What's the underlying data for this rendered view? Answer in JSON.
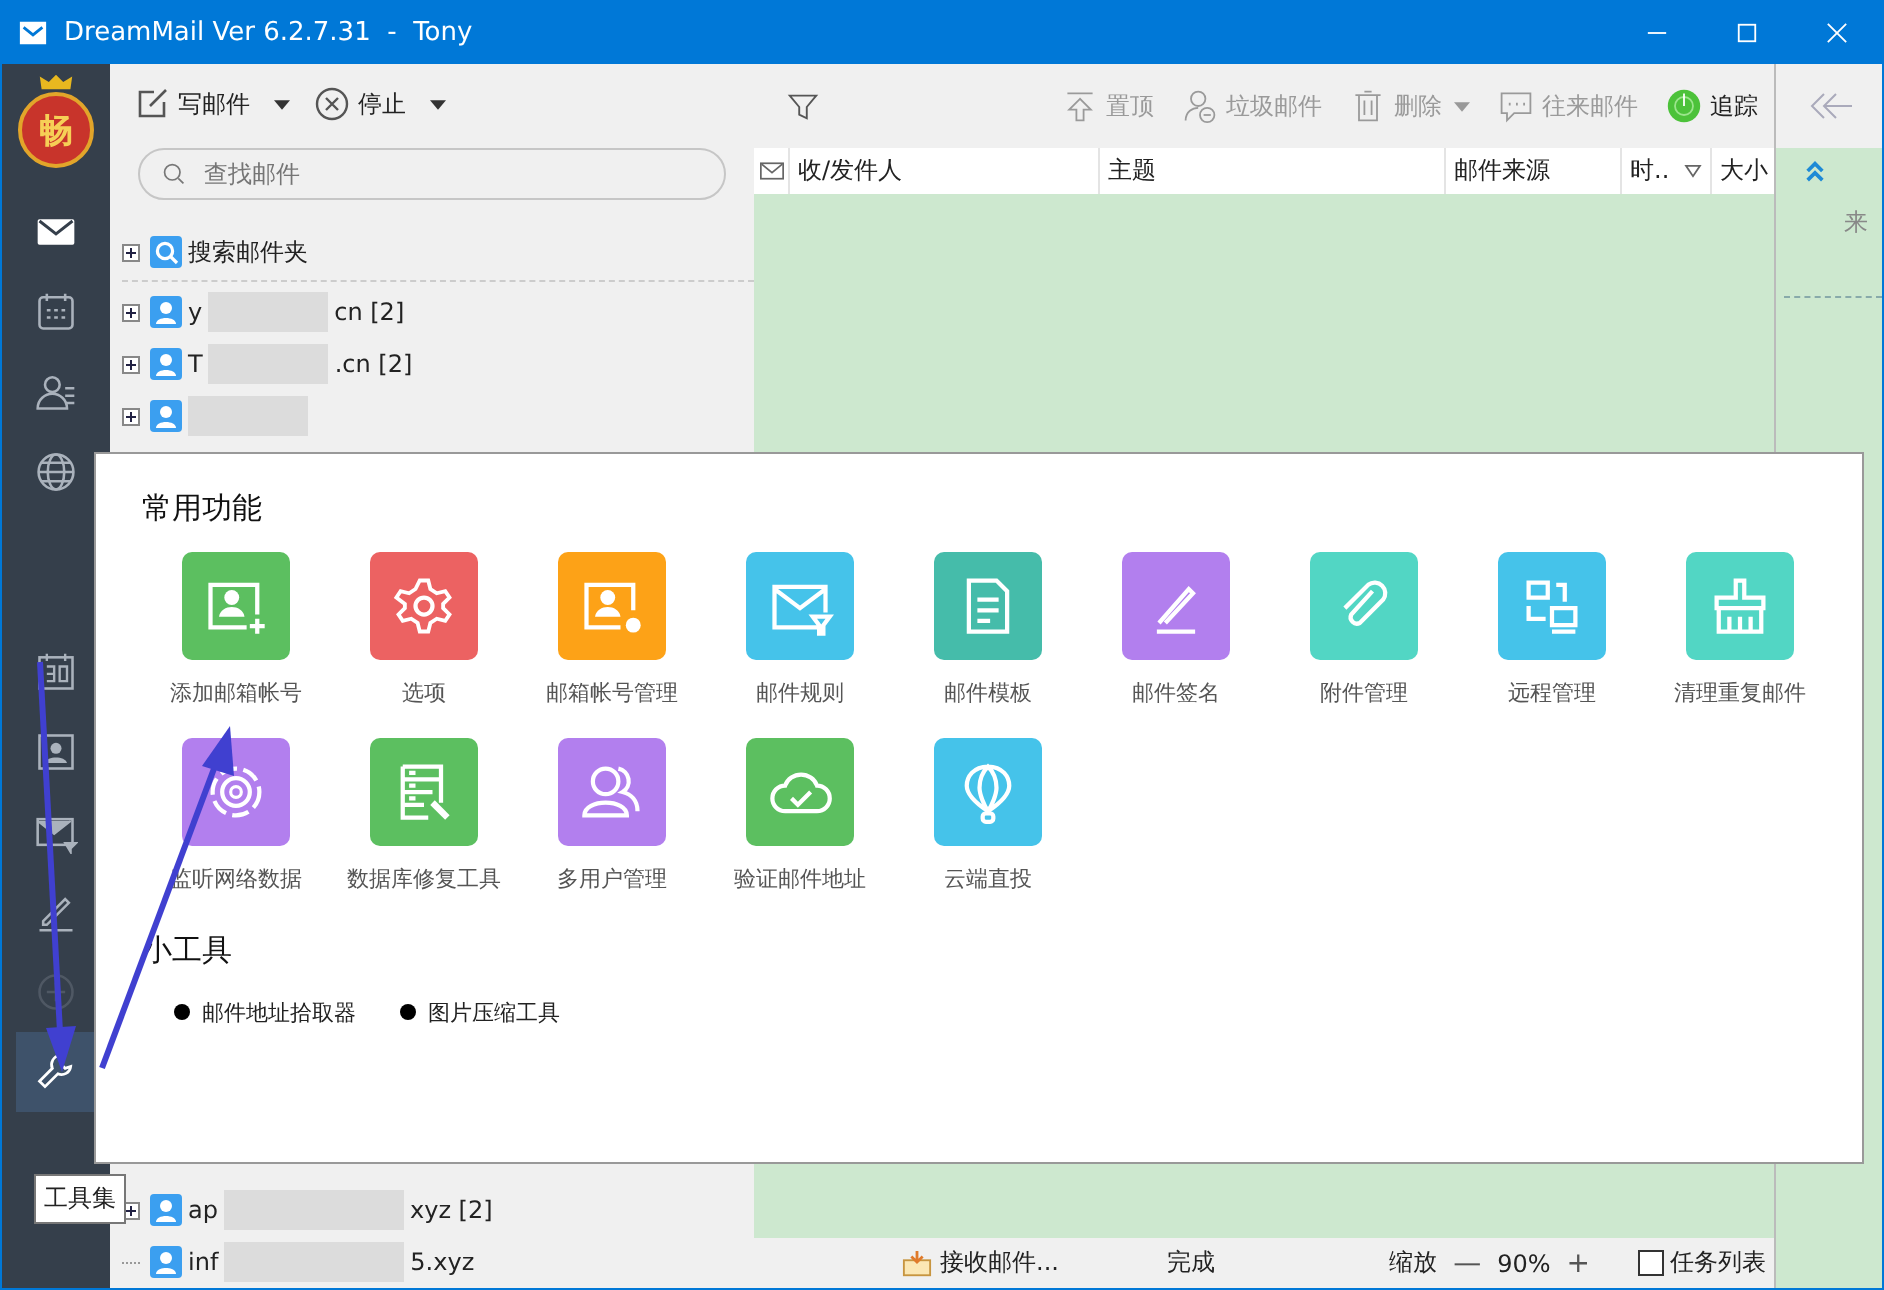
{
  "window": {
    "title": "DreamMail Ver 6.2.7.31  -  Tony"
  },
  "logo": {
    "text": "畅"
  },
  "sidebar": {
    "items": [
      {
        "kind": "mail",
        "selected": true
      },
      {
        "kind": "calendar",
        "selected": false
      },
      {
        "kind": "contacts",
        "selected": false
      },
      {
        "kind": "globe",
        "selected": false
      },
      {
        "kind": "date",
        "selected": false
      },
      {
        "kind": "card",
        "selected": false
      },
      {
        "kind": "filter",
        "selected": false
      },
      {
        "kind": "pen",
        "selected": false
      },
      {
        "kind": "plus",
        "selected": false
      },
      {
        "kind": "wrench",
        "selected": true
      }
    ]
  },
  "tooltip": "工具集",
  "toolbar": [
    {
      "kind": "compose",
      "label": "写邮件",
      "dropdown": true
    },
    {
      "kind": "stop",
      "label": "停止",
      "dropdown": true
    }
  ],
  "search": {
    "placeholder": "查找邮件"
  },
  "folders": [
    {
      "kind": "search",
      "label": "搜索邮件夹"
    },
    {
      "kind": "account",
      "label_start": "y",
      "label_end": "cn [2]"
    },
    {
      "kind": "account",
      "label_start": "T",
      "label_end": ".cn [2]"
    },
    {
      "kind": "group"
    }
  ],
  "folders_bottom": [
    {
      "label_start": "ap",
      "label_end": "xyz [2]",
      "expandable": true
    },
    {
      "label_start": "inf",
      "label_end": "5.xyz",
      "expandable": false
    }
  ],
  "mail_toolbar": [
    {
      "kind": "pin",
      "label": "置顶",
      "disabled": true,
      "dropdown": false
    },
    {
      "kind": "spam",
      "label": "垃圾邮件",
      "disabled": true,
      "dropdown": false
    },
    {
      "kind": "delete",
      "label": "删除",
      "disabled": true,
      "dropdown": true
    },
    {
      "kind": "thread",
      "label": "往来邮件",
      "disabled": true,
      "dropdown": false
    },
    {
      "kind": "track",
      "label": "追踪",
      "disabled": false,
      "dropdown": false
    }
  ],
  "table": {
    "columns": [
      {
        "label": "收/发件人",
        "sorted": false
      },
      {
        "label": "主题",
        "sorted": false
      },
      {
        "label": "邮件来源",
        "sorted": false
      },
      {
        "label": "时..",
        "sorted": true
      },
      {
        "label": "大小",
        "sorted": false
      }
    ]
  },
  "preview": {
    "from_label": "来"
  },
  "popup": {
    "sections": [
      {
        "kind": "tiles",
        "title": "常用功能",
        "tiles": [
          {
            "label": "添加邮箱帐号",
            "color": "#5cbf60"
          },
          {
            "label": "选项",
            "color": "#ec6262"
          },
          {
            "label": "邮箱帐号管理",
            "color": "#fda217"
          },
          {
            "label": "邮件规则",
            "color": "#45c3ea"
          },
          {
            "label": "邮件模板",
            "color": "#45bcaa"
          },
          {
            "label": "邮件签名",
            "color": "#b27fee"
          },
          {
            "label": "附件管理",
            "color": "#52d6c4"
          },
          {
            "label": "远程管理",
            "color": "#45c3ea"
          },
          {
            "label": "清理重复邮件",
            "color": "#52d6c4"
          },
          {
            "label": "监听网络数据",
            "color": "#b27fee"
          },
          {
            "label": "数据库修复工具",
            "color": "#5cbf60"
          },
          {
            "label": "多用户管理",
            "color": "#b27fee"
          },
          {
            "label": "验证邮件地址",
            "color": "#5cbf60"
          },
          {
            "label": "云端直投",
            "color": "#45c3ea"
          }
        ]
      },
      {
        "kind": "list",
        "title": "小工具",
        "items": [
          "邮件地址拾取器",
          "图片压缩工具"
        ]
      }
    ]
  },
  "status_bar": {
    "receiving": "接收邮件...",
    "state": "完成",
    "zoom_label": "缩放",
    "zoom_out": "—",
    "zoom": "90%",
    "zoom_in": "+",
    "task_list": {
      "label": "任务列表",
      "checked": false
    }
  }
}
